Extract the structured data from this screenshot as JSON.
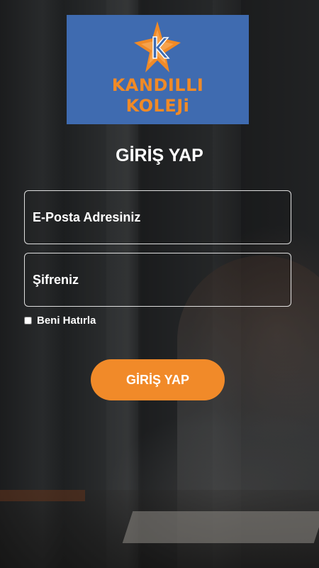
{
  "logo": {
    "line1": "KANDILLI",
    "line2": "KOLEJi",
    "background_color": "#3f6bb0",
    "text_color": "#f08a27",
    "icon": "star-k-logo-icon"
  },
  "login": {
    "title": "GİRİŞ YAP",
    "email_placeholder": "E-Posta Adresiniz",
    "email_value": "",
    "password_placeholder": "Şifreniz",
    "password_value": "",
    "remember_label": "Beni Hatırla",
    "remember_checked": false,
    "submit_label": "GİRİŞ YAP",
    "accent_color": "#f18a29"
  }
}
